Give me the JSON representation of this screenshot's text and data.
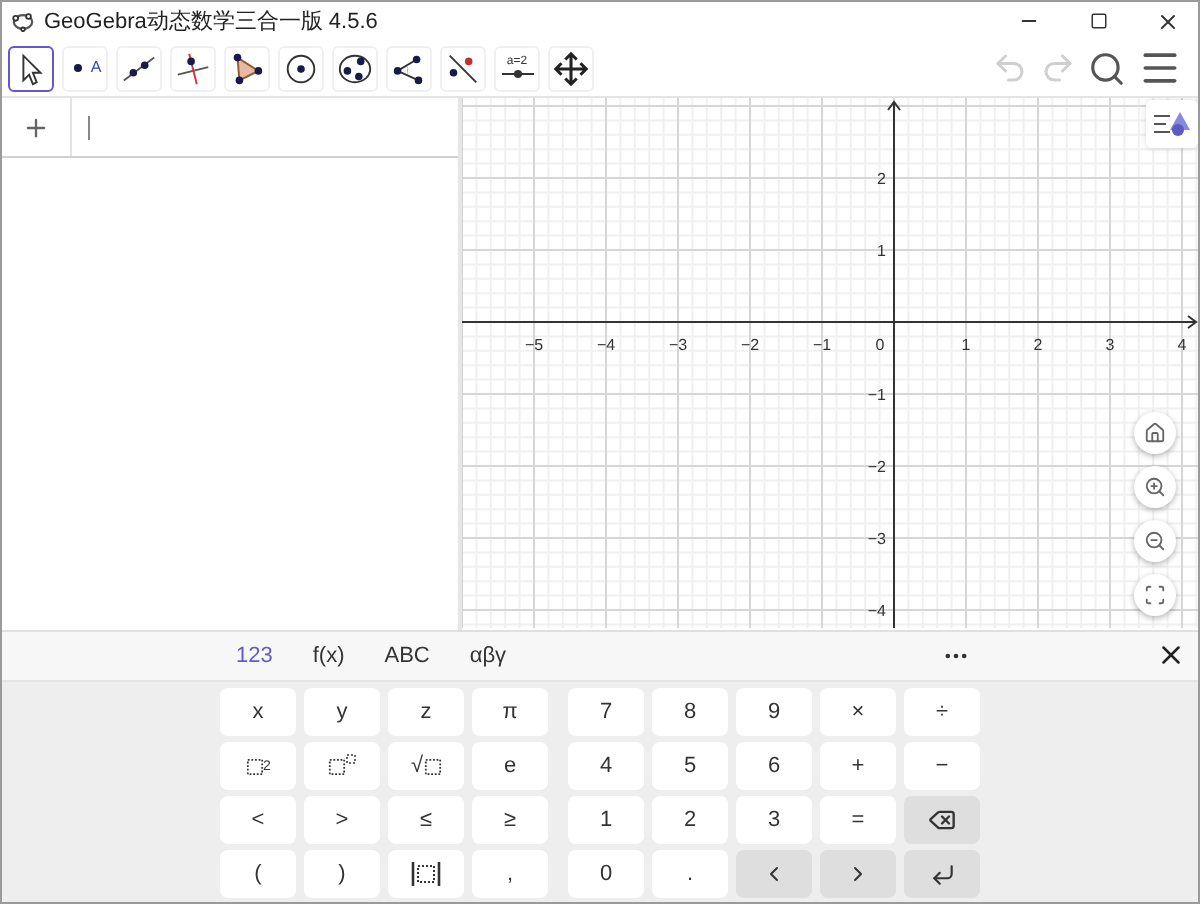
{
  "window": {
    "title": "GeoGebra动态数学三合一版 4.5.6"
  },
  "toolbar": {
    "tools": [
      {
        "kind": "move",
        "selected": true
      },
      {
        "kind": "point",
        "label": "A",
        "selected": false
      },
      {
        "kind": "line",
        "selected": false
      },
      {
        "kind": "perpendicular",
        "selected": false
      },
      {
        "kind": "polygon",
        "selected": false
      },
      {
        "kind": "circle",
        "selected": false
      },
      {
        "kind": "conic",
        "selected": false
      },
      {
        "kind": "angle",
        "selected": false
      },
      {
        "kind": "reflect",
        "selected": false
      },
      {
        "kind": "slider",
        "label": "a=2",
        "selected": false
      },
      {
        "kind": "move_view",
        "selected": false
      }
    ],
    "undo": {
      "disabled": true
    },
    "redo": {
      "disabled": true
    }
  },
  "graphics": {
    "x_labels": [
      "−5",
      "−4",
      "−3",
      "−2",
      "−1",
      "0",
      "1",
      "2",
      "3",
      "4"
    ],
    "y_labels": [
      "2",
      "1",
      "−1",
      "−2",
      "−3",
      "−4"
    ]
  },
  "keyboard": {
    "tabs": [
      {
        "label": "123",
        "selected": true
      },
      {
        "label": "f(x)",
        "selected": false
      },
      {
        "label": "ABC",
        "selected": false
      },
      {
        "label": "αβγ",
        "selected": false
      }
    ],
    "left_keys": [
      [
        {
          "kind": "text",
          "label": "x"
        },
        {
          "kind": "text",
          "label": "y"
        },
        {
          "kind": "text",
          "label": "z"
        },
        {
          "kind": "text",
          "label": "π"
        }
      ],
      [
        {
          "kind": "square",
          "label": "2"
        },
        {
          "kind": "power"
        },
        {
          "kind": "sqrt",
          "label": "√"
        },
        {
          "kind": "text",
          "label": "e"
        }
      ],
      [
        {
          "kind": "text",
          "label": "<"
        },
        {
          "kind": "text",
          "label": ">"
        },
        {
          "kind": "text",
          "label": "≤"
        },
        {
          "kind": "text",
          "label": "≥"
        }
      ],
      [
        {
          "kind": "text",
          "label": "("
        },
        {
          "kind": "text",
          "label": ")"
        },
        {
          "kind": "abs"
        },
        {
          "kind": "text",
          "label": ","
        }
      ]
    ],
    "right_keys": [
      [
        {
          "kind": "text",
          "label": "7"
        },
        {
          "kind": "text",
          "label": "8"
        },
        {
          "kind": "text",
          "label": "9"
        },
        {
          "kind": "text",
          "label": "×"
        },
        {
          "kind": "text",
          "label": "÷"
        }
      ],
      [
        {
          "kind": "text",
          "label": "4"
        },
        {
          "kind": "text",
          "label": "5"
        },
        {
          "kind": "text",
          "label": "6"
        },
        {
          "kind": "text",
          "label": "+"
        },
        {
          "kind": "text",
          "label": "−"
        }
      ],
      [
        {
          "kind": "text",
          "label": "1"
        },
        {
          "kind": "text",
          "label": "2"
        },
        {
          "kind": "text",
          "label": "3"
        },
        {
          "kind": "text",
          "label": "="
        },
        {
          "kind": "backspace"
        }
      ],
      [
        {
          "kind": "text",
          "label": "0"
        },
        {
          "kind": "text",
          "label": "."
        },
        {
          "kind": "left"
        },
        {
          "kind": "right"
        },
        {
          "kind": "enter"
        }
      ]
    ]
  }
}
